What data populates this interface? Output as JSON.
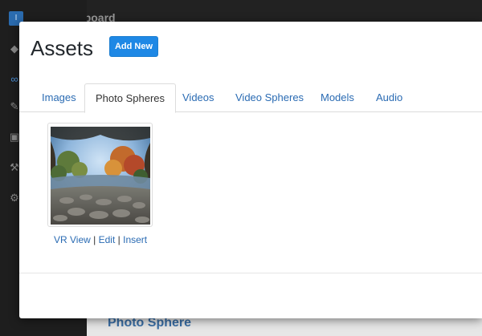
{
  "background": {
    "sidebar_logo": "I",
    "dashboard_label": "Dashboard",
    "bg_section_title": "Photo Sphere",
    "sidebar_icons": [
      "cube-icon",
      "link-icon",
      "pencil-icon",
      "image-icon",
      "wrench-icon",
      "gear-icon"
    ]
  },
  "modal": {
    "title": "Assets",
    "add_new_label": "Add New",
    "tabs": [
      {
        "label": "Images",
        "active": false
      },
      {
        "label": "Photo Spheres",
        "active": true
      },
      {
        "label": "Videos",
        "active": false
      },
      {
        "label": "Video Spheres",
        "active": false
      },
      {
        "label": "Models",
        "active": false
      },
      {
        "label": "Audio",
        "active": false
      }
    ],
    "asset": {
      "link_vr_view": "VR View",
      "separator": "|",
      "link_edit": "Edit",
      "link_insert": "Insert"
    }
  },
  "colors": {
    "accent": "#1e88e5",
    "link": "#2a6bb3"
  }
}
